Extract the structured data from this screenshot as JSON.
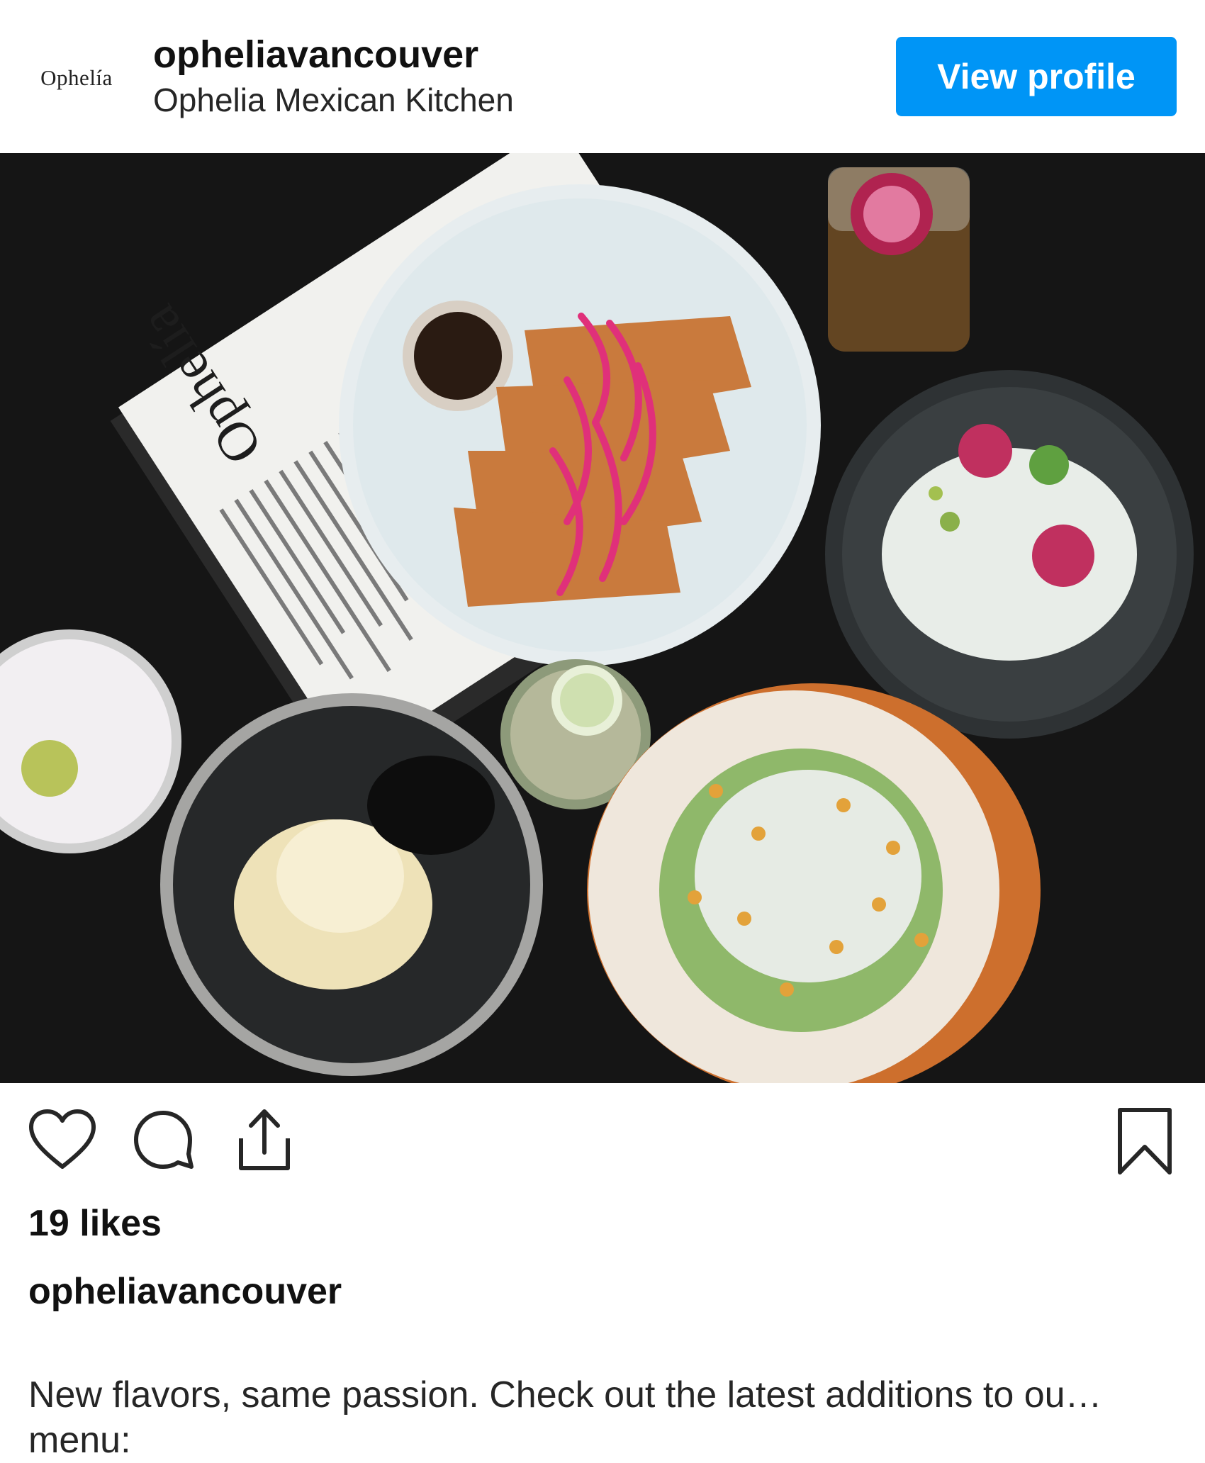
{
  "post": {
    "username": "opheliavancouver",
    "display_name": "Ophelia Mexican Kitchen",
    "avatar_text": "Ophelía",
    "view_profile_label": "View profile",
    "accent_color": "#0095f6",
    "photo": {
      "menu_title": "Ophelía",
      "icon": "food-photo"
    },
    "actions": {
      "like_icon": "heart-icon",
      "comment_icon": "comment-icon",
      "share_icon": "share-icon",
      "save_icon": "bookmark-icon"
    },
    "likes": "19 likes",
    "caption_username": "opheliavancouver",
    "caption_line1": "New flavors, same passion. Check out the latest additions to ou…",
    "caption_line2": "menu:"
  }
}
